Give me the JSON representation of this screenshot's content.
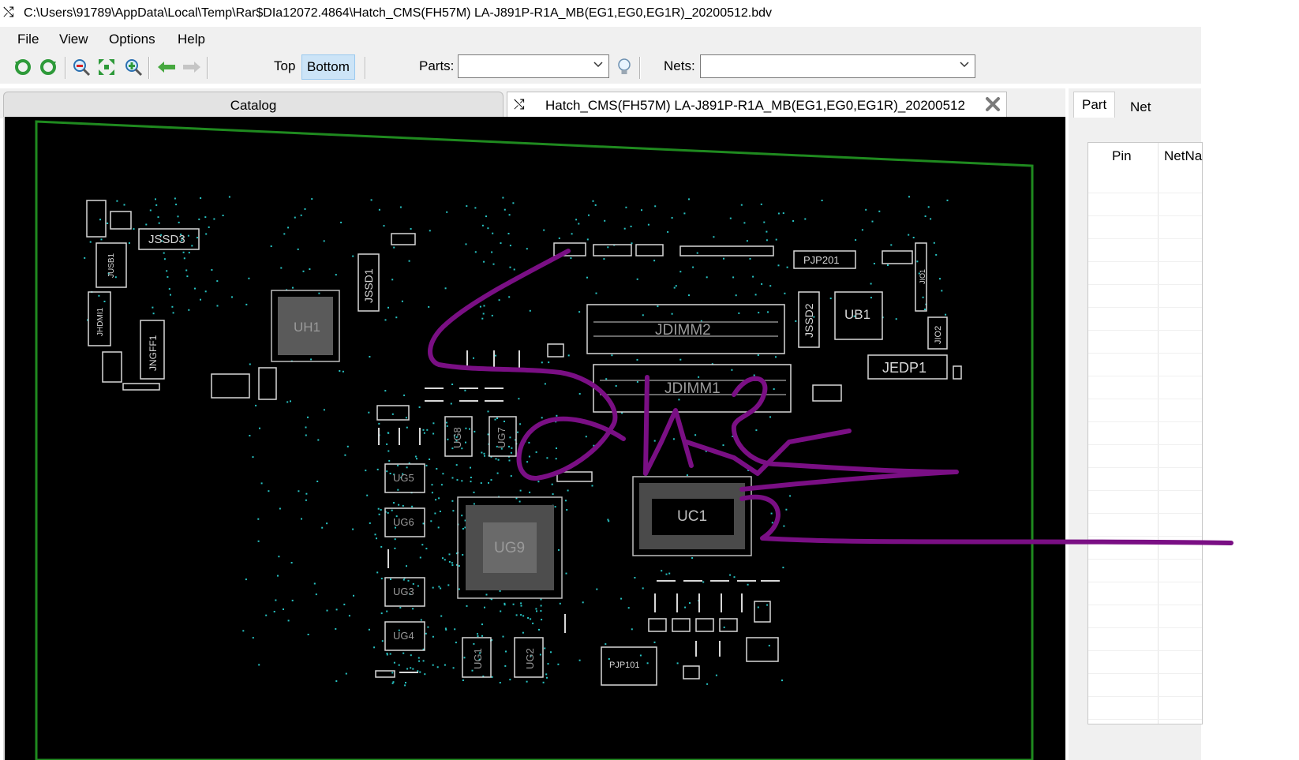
{
  "window": {
    "title": "C:\\Users\\91789\\AppData\\Local\\Temp\\Rar$DIa12072.4864\\Hatch_CMS(FH57M) LA-J891P-R1A_MB(EG1,EG0,EG1R)_20200512.bdv",
    "icon": "shuffle-icon"
  },
  "menu": {
    "file": "File",
    "view": "View",
    "options": "Options",
    "help": "Help"
  },
  "toolbar": {
    "top_label": "Top",
    "bottom_label": "Bottom",
    "parts_label": "Parts:",
    "parts_value": "",
    "nets_label": "Nets:",
    "nets_value": "",
    "icons": [
      "rotate-left-icon",
      "rotate-right-icon",
      "zoom-out-icon",
      "fit-icon",
      "zoom-in-icon",
      "arrow-left-icon",
      "arrow-right-icon",
      "bulb-icon"
    ]
  },
  "tabs": {
    "catalog": "Catalog",
    "document": "Hatch_CMS(FH57M) LA-J891P-R1A_MB(EG1,EG0,EG1R)_20200512"
  },
  "board": {
    "labels": {
      "jssd3": "JSSD3",
      "jusb1": "JUSB1",
      "jhdmi1": "JHDMI1",
      "jngff1": "JNGFF1",
      "uh1": "UH1",
      "jssd1": "JSSD1",
      "jdimm2": "JDIMM2",
      "jdimm1": "JDIMM1",
      "pjp201": "PJP201",
      "jssd2": "JSSD2",
      "ub1": "UB1",
      "jio1": "JIO1",
      "jio2": "JIO2",
      "jedp1": "JEDP1",
      "ug8": "UG8",
      "ug7": "UG7",
      "ug5": "UG5",
      "ug6": "UG6",
      "ug9": "UG9",
      "ug3": "UG3",
      "ug4": "UG4",
      "ug1": "UG1",
      "ug2": "UG2",
      "uc1": "UC1",
      "pjp101": "PJP101"
    },
    "outline_color": "#1f8a1f",
    "silk_color": "#d8d8d8"
  },
  "side": {
    "part_tab": "Part",
    "net_tab": "Net",
    "col_pin": "Pin",
    "col_netname": "NetNa"
  },
  "annotation": {
    "color": "#7a0f84"
  }
}
